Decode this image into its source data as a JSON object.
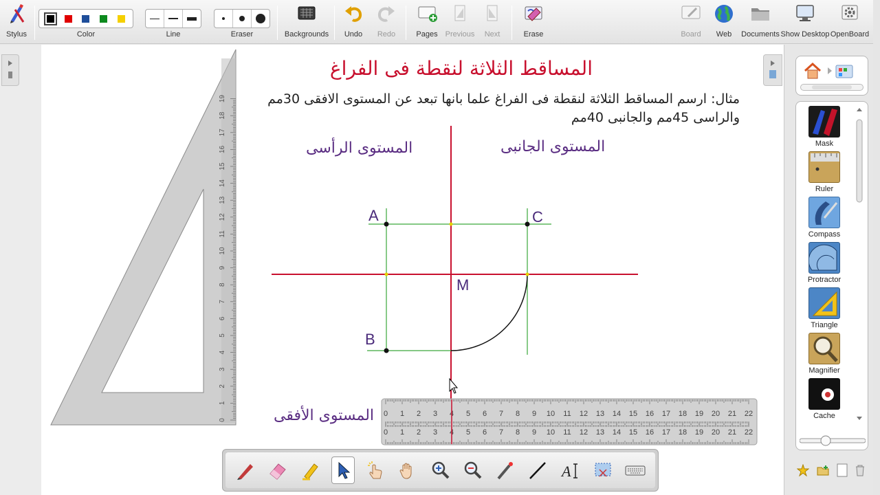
{
  "toolbar": {
    "stylus": {
      "label": "Stylus",
      "icon": "stylus-icon"
    },
    "color": {
      "label": "Color",
      "swatches": [
        "#000000",
        "#e00000",
        "#1f4e9a",
        "#0d8a1e",
        "#f5d000"
      ],
      "selected": "#000000"
    },
    "line": {
      "label": "Line"
    },
    "eraser": {
      "label": "Eraser"
    },
    "backgrounds": {
      "label": "Backgrounds",
      "icon": "backgrounds-icon"
    },
    "undo": {
      "label": "Undo",
      "icon": "undo-icon"
    },
    "redo": {
      "label": "Redo",
      "icon": "redo-icon"
    },
    "pages": {
      "label": "Pages",
      "icon": "add-page-icon"
    },
    "previous": {
      "label": "Previous",
      "icon": "previous-page-icon"
    },
    "next": {
      "label": "Next",
      "icon": "next-page-icon"
    },
    "erase": {
      "label": "Erase",
      "icon": "erase-board-icon"
    },
    "board": {
      "label": "Board",
      "icon": "board-icon"
    },
    "web": {
      "label": "Web",
      "icon": "globe-icon"
    },
    "documents": {
      "label": "Documents",
      "icon": "folder-icon"
    },
    "show_desktop": {
      "label": "Show Desktop",
      "icon": "monitor-icon"
    },
    "openboard": {
      "label": "OpenBoard",
      "icon": "gear-icon"
    }
  },
  "board": {
    "title": "المساقط الثلاثة لنقطة فى الفراغ",
    "problem_line1": "مثال: ارسم المساقط الثلاثة لنقطة فى الفراغ علما بانها تبعد عن المستوى الافقى 30مم",
    "problem_line2": "والراسى 45مم والجانبى 40مم",
    "label_vertical_plane": "المستوى الرأسى",
    "label_side_plane": "المستوى الجانبى",
    "label_horizontal_plane": "المستوى الأفقى",
    "points": {
      "A": "A",
      "B": "B",
      "C": "C",
      "M": "M"
    },
    "colors": {
      "axis": "#c8102e",
      "construction": "#3aa63a",
      "point": "#000000",
      "label": "#5a2d82"
    },
    "ruler_numbers": [
      "0",
      "1",
      "2",
      "3",
      "4",
      "5",
      "6",
      "7",
      "8",
      "9",
      "10",
      "11",
      "12",
      "13",
      "14",
      "15",
      "16",
      "17",
      "18",
      "19",
      "20",
      "21",
      "22"
    ],
    "triangle_numbers": [
      "0",
      "1",
      "2",
      "3",
      "4",
      "5",
      "6",
      "7",
      "8",
      "9",
      "10",
      "11",
      "12",
      "13",
      "14",
      "15",
      "16",
      "17",
      "18",
      "19"
    ]
  },
  "dock": {
    "tools": [
      {
        "name": "pen-tool",
        "icon": "pen-icon"
      },
      {
        "name": "eraser-tool",
        "icon": "eraser-icon"
      },
      {
        "name": "marker-tool",
        "icon": "highlighter-icon"
      },
      {
        "name": "selector-tool",
        "icon": "arrow-cursor-icon",
        "selected": true
      },
      {
        "name": "interact-tool",
        "icon": "pointing-hand-icon"
      },
      {
        "name": "hand-tool",
        "icon": "hand-icon"
      },
      {
        "name": "zoom-in-tool",
        "icon": "zoom-in-icon"
      },
      {
        "name": "zoom-out-tool",
        "icon": "zoom-out-icon"
      },
      {
        "name": "laser-pointer-tool",
        "icon": "laser-pointer-icon"
      },
      {
        "name": "line-tool",
        "icon": "line-icon"
      },
      {
        "name": "text-tool",
        "icon": "text-icon"
      },
      {
        "name": "capture-tool",
        "icon": "capture-icon"
      },
      {
        "name": "keyboard-tool",
        "icon": "keyboard-icon"
      }
    ]
  },
  "library": {
    "items": [
      {
        "label": "Mask",
        "icon": "mask-icon"
      },
      {
        "label": "Ruler",
        "icon": "ruler-icon"
      },
      {
        "label": "Compass",
        "icon": "compass-icon"
      },
      {
        "label": "Protractor",
        "icon": "protractor-icon"
      },
      {
        "label": "Triangle",
        "icon": "triangle-icon"
      },
      {
        "label": "Magnifier",
        "icon": "magnifier-icon"
      },
      {
        "label": "Cache",
        "icon": "cache-icon"
      }
    ]
  }
}
